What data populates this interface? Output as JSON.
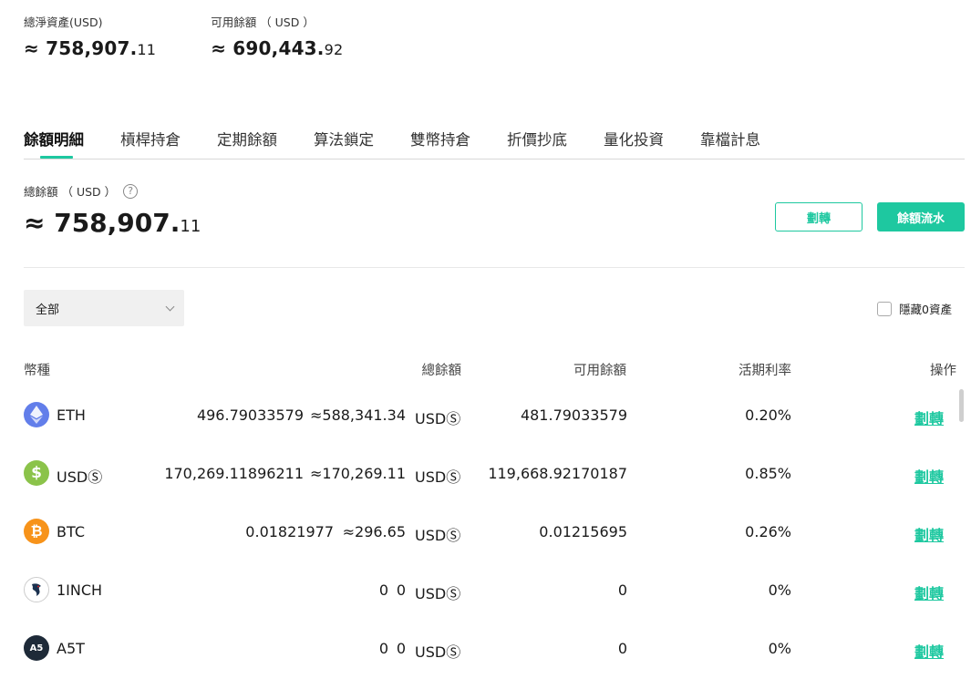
{
  "summary": {
    "net_assets_label": "總淨資產(USD)",
    "net_assets_int": "≈ 758,907.",
    "net_assets_dec": "11",
    "available_label": "可用餘額 （ USD ）",
    "available_int": "≈ 690,443.",
    "available_dec": "92"
  },
  "tabs": [
    {
      "label": "餘額明細",
      "active": true
    },
    {
      "label": "槓桿持倉"
    },
    {
      "label": "定期餘額"
    },
    {
      "label": "算法鎖定"
    },
    {
      "label": "雙幣持倉"
    },
    {
      "label": "折價抄底"
    },
    {
      "label": "量化投資"
    },
    {
      "label": "靠檔計息"
    }
  ],
  "total": {
    "label": "總餘額 （ USD ）",
    "help_glyph": "?",
    "value_int": "≈ 758,907.",
    "value_dec": "11"
  },
  "buttons": {
    "transfer": "劃轉",
    "flow": "餘額流水"
  },
  "filter": {
    "selected": "全部",
    "hide_zero_label": "隱藏0資產"
  },
  "table": {
    "headers": [
      "幣種",
      "總餘額",
      "可用餘額",
      "活期利率",
      "操作"
    ],
    "rows": [
      {
        "coin": "ETH",
        "icon": "eth-icon",
        "total": "496.79033579",
        "approx": "≈588,341.34",
        "unit": "USDⓈ",
        "available": "481.79033579",
        "rate": "0.20%",
        "op": "劃轉"
      },
      {
        "coin": "USDⓈ",
        "icon": "usds-icon",
        "total": "170,269.11896211",
        "approx": "≈170,269.11",
        "unit": "USDⓈ",
        "available": "119,668.92170187",
        "rate": "0.85%",
        "op": "劃轉"
      },
      {
        "coin": "BTC",
        "icon": "btc-icon",
        "total": "0.01821977",
        "approx": "≈296.65",
        "unit": "USDⓈ",
        "available": "0.01215695",
        "rate": "0.26%",
        "op": "劃轉"
      },
      {
        "coin": "1INCH",
        "icon": "1inch-icon",
        "total": "0",
        "approx": "0",
        "unit": "USDⓈ",
        "available": "0",
        "rate": "0%",
        "op": "劃轉"
      },
      {
        "coin": "A5T",
        "icon": "a5t-icon",
        "total": "0",
        "approx": "0",
        "unit": "USDⓈ",
        "available": "0",
        "rate": "0%",
        "op": "劃轉"
      }
    ]
  },
  "colors": {
    "accent": "#1ec8a0",
    "eth": "#627eea",
    "usds": "#8bc34a",
    "btc": "#f7931a",
    "a5t": "#1e2a38"
  }
}
